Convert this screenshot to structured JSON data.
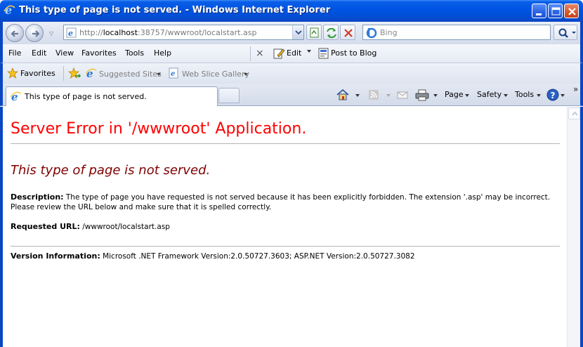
{
  "window": {
    "title": "This type of page is not served. - Windows Internet Explorer"
  },
  "address": {
    "url_prefix": "http://",
    "url_host": "localhost",
    "url_rest": ":38757/wwwroot/localstart.asp",
    "search_placeholder": "Bing"
  },
  "menu": {
    "items": [
      "File",
      "Edit",
      "View",
      "Favorites",
      "Tools",
      "Help"
    ],
    "edit_label": "Edit",
    "blog_label": "Post to Blog"
  },
  "favorites": {
    "label": "Favorites",
    "links": [
      "Suggested Sites",
      "Web Slice Gallery"
    ]
  },
  "tabs": {
    "active_title": "This type of page is not served."
  },
  "commandbar": {
    "page": "Page",
    "safety": "Safety",
    "tools": "Tools"
  },
  "page": {
    "heading": "Server Error in '/wwwroot' Application.",
    "error_title": "This type of page is not served.",
    "description_label": "Description:",
    "description_text": "The type of page you have requested is not served because it has been explicitly forbidden.  The extension '.asp' may be incorrect.   Please review the URL below and make sure that it is spelled correctly.",
    "requested_label": "Requested URL:",
    "requested_value": "/wwwroot/localstart.asp",
    "version_label": "Version Information:",
    "version_value": "Microsoft .NET Framework Version:2.0.50727.3603; ASP.NET Version:2.0.50727.3082"
  },
  "colors": {
    "heading": "#ff0000",
    "error_title": "#800000",
    "titlebar": "#0054e3"
  }
}
